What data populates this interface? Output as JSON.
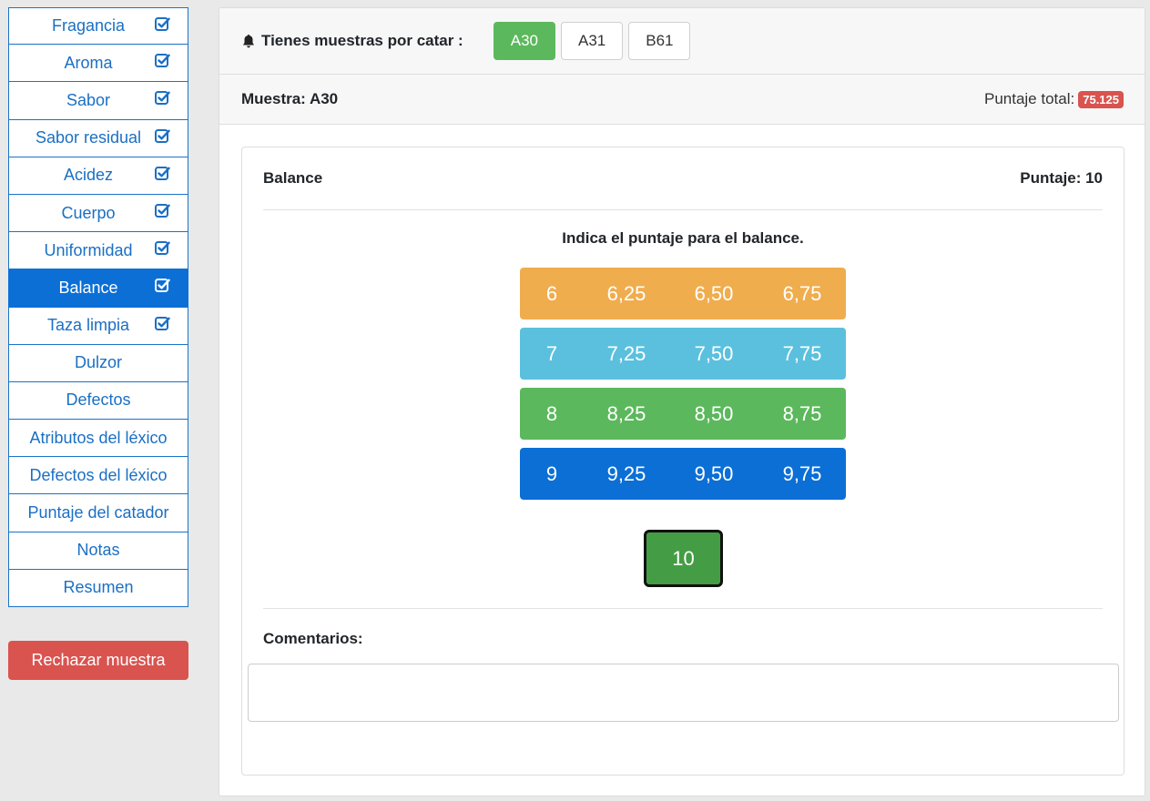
{
  "sidebar": {
    "items": [
      {
        "label": "Fragancia",
        "checked": true,
        "active": false
      },
      {
        "label": "Aroma",
        "checked": true,
        "active": false
      },
      {
        "label": "Sabor",
        "checked": true,
        "active": false
      },
      {
        "label": "Sabor residual",
        "checked": true,
        "active": false
      },
      {
        "label": "Acidez",
        "checked": true,
        "active": false
      },
      {
        "label": "Cuerpo",
        "checked": true,
        "active": false
      },
      {
        "label": "Uniformidad",
        "checked": true,
        "active": false
      },
      {
        "label": "Balance",
        "checked": true,
        "active": true
      },
      {
        "label": "Taza limpia",
        "checked": true,
        "active": false
      },
      {
        "label": "Dulzor",
        "checked": false,
        "active": false
      },
      {
        "label": "Defectos",
        "checked": false,
        "active": false
      },
      {
        "label": "Atributos del léxico",
        "checked": false,
        "active": false
      },
      {
        "label": "Defectos del léxico",
        "checked": false,
        "active": false
      },
      {
        "label": "Puntaje del catador",
        "checked": false,
        "active": false
      },
      {
        "label": "Notas",
        "checked": false,
        "active": false
      },
      {
        "label": "Resumen",
        "checked": false,
        "active": false
      }
    ],
    "reject_label": "Rechazar muestra"
  },
  "topbar": {
    "pending_label": "Tienes muestras por catar :",
    "samples": [
      {
        "label": "A30",
        "active": true
      },
      {
        "label": "A31",
        "active": false
      },
      {
        "label": "B61",
        "active": false
      }
    ]
  },
  "samplebar": {
    "title": "Muestra: A30",
    "total_label": "Puntaje total:",
    "total_value": "75.125"
  },
  "card": {
    "attribute": "Balance",
    "score_label": "Puntaje: 10",
    "instruction": "Indica el puntaje para el balance.",
    "rows": [
      {
        "color": "#f0ad4e",
        "options": [
          "6",
          "6,25",
          "6,50",
          "6,75"
        ]
      },
      {
        "color": "#5bc0de",
        "options": [
          "7",
          "7,25",
          "7,50",
          "7,75"
        ]
      },
      {
        "color": "#5cb85c",
        "options": [
          "8",
          "8,25",
          "8,50",
          "8,75"
        ]
      },
      {
        "color": "#0b6fd6",
        "options": [
          "9",
          "9,25",
          "9,50",
          "9,75"
        ]
      }
    ],
    "max_option": "10",
    "comments_label": "Comentarios:",
    "comments_value": ""
  },
  "colors": {
    "accent": "#0b6fd6",
    "success": "#5cb85c",
    "danger": "#d9534f"
  }
}
